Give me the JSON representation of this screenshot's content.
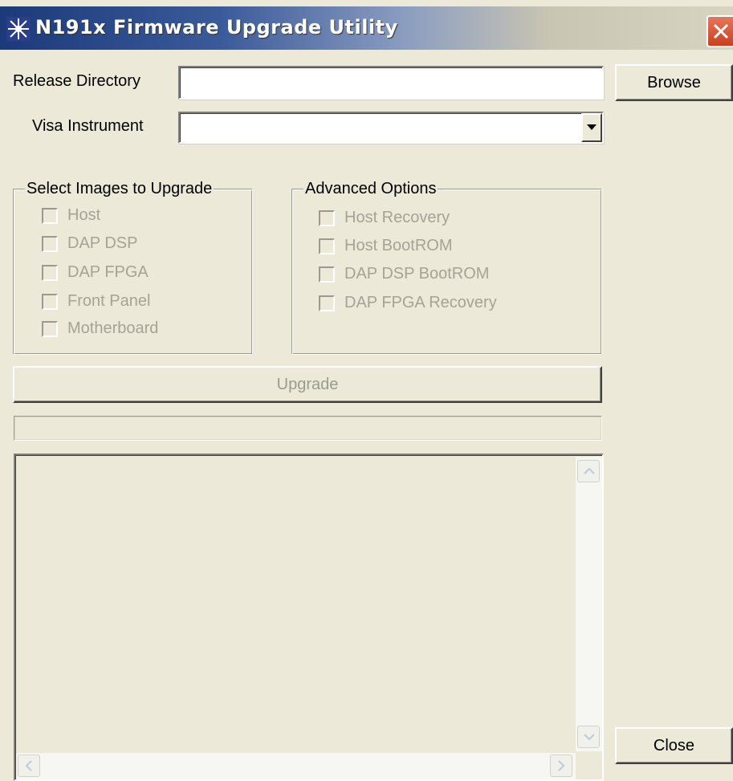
{
  "window": {
    "title": "N191x Firmware Upgrade Utility"
  },
  "form": {
    "release_directory_label": "Release Directory",
    "release_directory_value": "",
    "visa_instrument_label": "Visa Instrument",
    "visa_instrument_value": "",
    "browse_label": "Browse"
  },
  "images_group": {
    "title": "Select Images to Upgrade",
    "items": [
      {
        "label": "Host",
        "checked": false,
        "enabled": false
      },
      {
        "label": "DAP DSP",
        "checked": false,
        "enabled": false
      },
      {
        "label": "DAP FPGA",
        "checked": false,
        "enabled": false
      },
      {
        "label": "Front Panel",
        "checked": false,
        "enabled": false
      },
      {
        "label": "Motherboard",
        "checked": false,
        "enabled": false
      }
    ]
  },
  "advanced_group": {
    "title": "Advanced Options",
    "items": [
      {
        "label": "Host Recovery",
        "checked": false,
        "enabled": false
      },
      {
        "label": "Host BootROM",
        "checked": false,
        "enabled": false
      },
      {
        "label": "DAP DSP BootROM",
        "checked": false,
        "enabled": false
      },
      {
        "label": "DAP FPGA Recovery",
        "checked": false,
        "enabled": false
      }
    ]
  },
  "actions": {
    "upgrade_label": "Upgrade",
    "close_label": "Close"
  },
  "progress": {
    "value": 0
  },
  "log": {
    "text": ""
  },
  "colors": {
    "face": "#ECE9D8",
    "disabled_text": "#A5A396",
    "close_button_red": "#C9401E"
  }
}
